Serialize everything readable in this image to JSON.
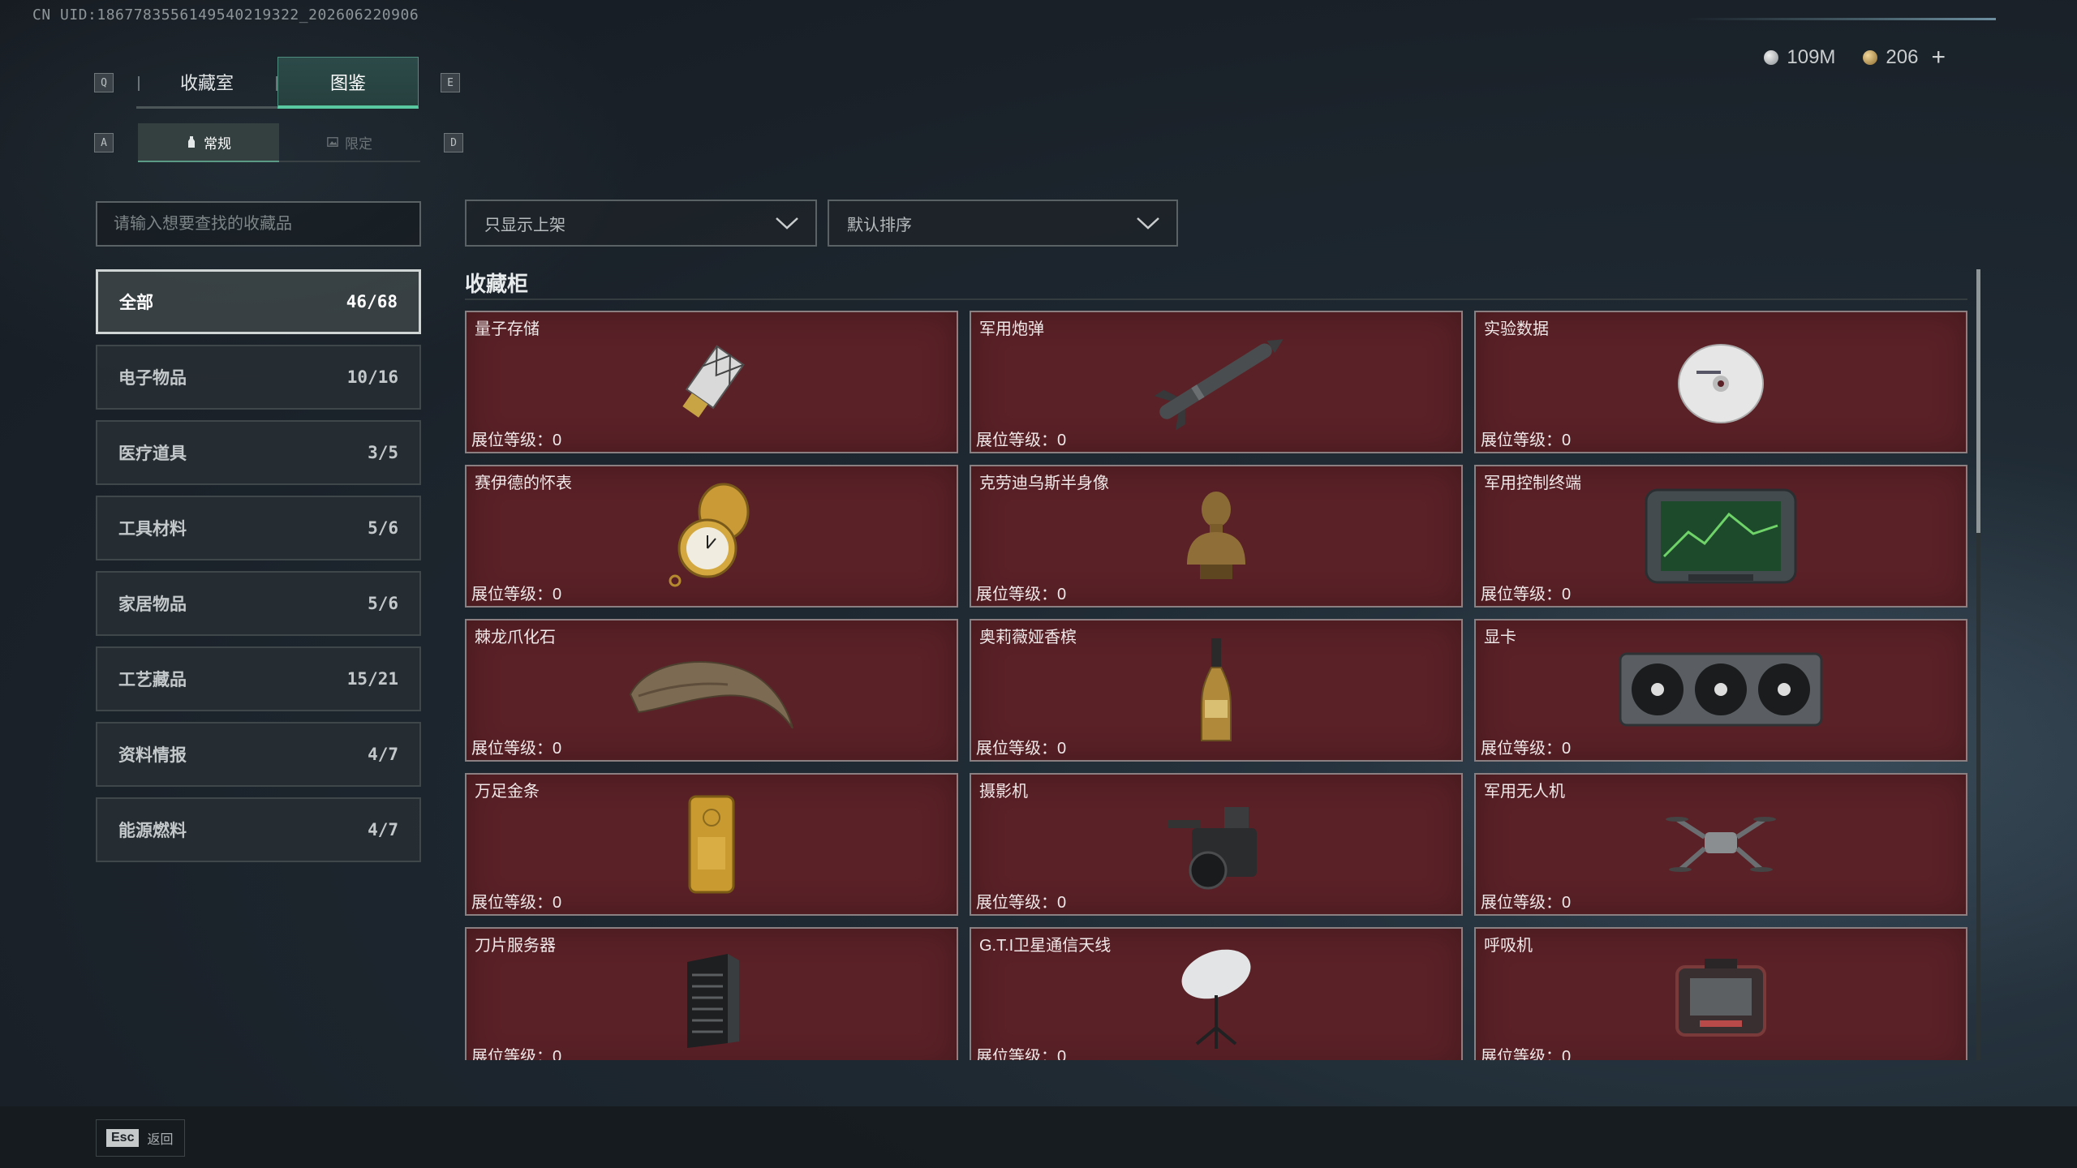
{
  "header": {
    "uid": "CN UID:1867783556149540219322_202606220906",
    "currency": [
      {
        "icon": "silver-coin-icon",
        "value": "109M"
      },
      {
        "icon": "gold-coin-icon",
        "value": "206"
      }
    ],
    "plus": "+"
  },
  "keys": {
    "prev_tab": "Q",
    "next_tab": "E",
    "prev_sub": "A",
    "next_sub": "D"
  },
  "main_tabs": [
    {
      "label": "收藏室",
      "active": false
    },
    {
      "label": "图鉴",
      "active": true
    }
  ],
  "sub_tabs": [
    {
      "label": "常规",
      "active": true
    },
    {
      "label": "限定",
      "active": false
    }
  ],
  "search": {
    "placeholder": "请输入想要查找的收藏品",
    "value": ""
  },
  "categories": [
    {
      "label": "全部",
      "count": "46/68",
      "active": true
    },
    {
      "label": "电子物品",
      "count": "10/16"
    },
    {
      "label": "医疗道具",
      "count": "3/5"
    },
    {
      "label": "工具材料",
      "count": "5/6"
    },
    {
      "label": "家居物品",
      "count": "5/6"
    },
    {
      "label": "工艺藏品",
      "count": "15/21"
    },
    {
      "label": "资料情报",
      "count": "4/7"
    },
    {
      "label": "能源燃料",
      "count": "4/7"
    }
  ],
  "filters": {
    "shelf": "只显示上架",
    "sort": "默认排序"
  },
  "section_title": "收藏柜",
  "level_label": "展位等级：0",
  "items": [
    {
      "name": "量子存储",
      "icon": "usb-drive-icon"
    },
    {
      "name": "军用炮弹",
      "icon": "missile-icon"
    },
    {
      "name": "实验数据",
      "icon": "disc-icon"
    },
    {
      "name": "赛伊德的怀表",
      "icon": "pocket-watch-icon"
    },
    {
      "name": "克劳迪乌斯半身像",
      "icon": "bust-icon"
    },
    {
      "name": "军用控制终端",
      "icon": "tablet-terminal-icon"
    },
    {
      "name": "棘龙爪化石",
      "icon": "claw-fossil-icon"
    },
    {
      "name": "奥莉薇娅香槟",
      "icon": "champagne-icon"
    },
    {
      "name": "显卡",
      "icon": "graphics-card-icon"
    },
    {
      "name": "万足金条",
      "icon": "gold-bar-icon"
    },
    {
      "name": "摄影机",
      "icon": "video-camera-icon"
    },
    {
      "name": "军用无人机",
      "icon": "drone-icon"
    },
    {
      "name": "刀片服务器",
      "icon": "server-icon"
    },
    {
      "name": "G.T.I卫星通信天线",
      "icon": "satellite-dish-icon"
    },
    {
      "name": "呼吸机",
      "icon": "ventilator-icon"
    }
  ],
  "footer": {
    "esc_key": "Esc",
    "esc_label": "返回"
  },
  "colors": {
    "accent": "#59c9a2",
    "card_bg": "#5a2127",
    "card_border": "#8b7f81"
  }
}
